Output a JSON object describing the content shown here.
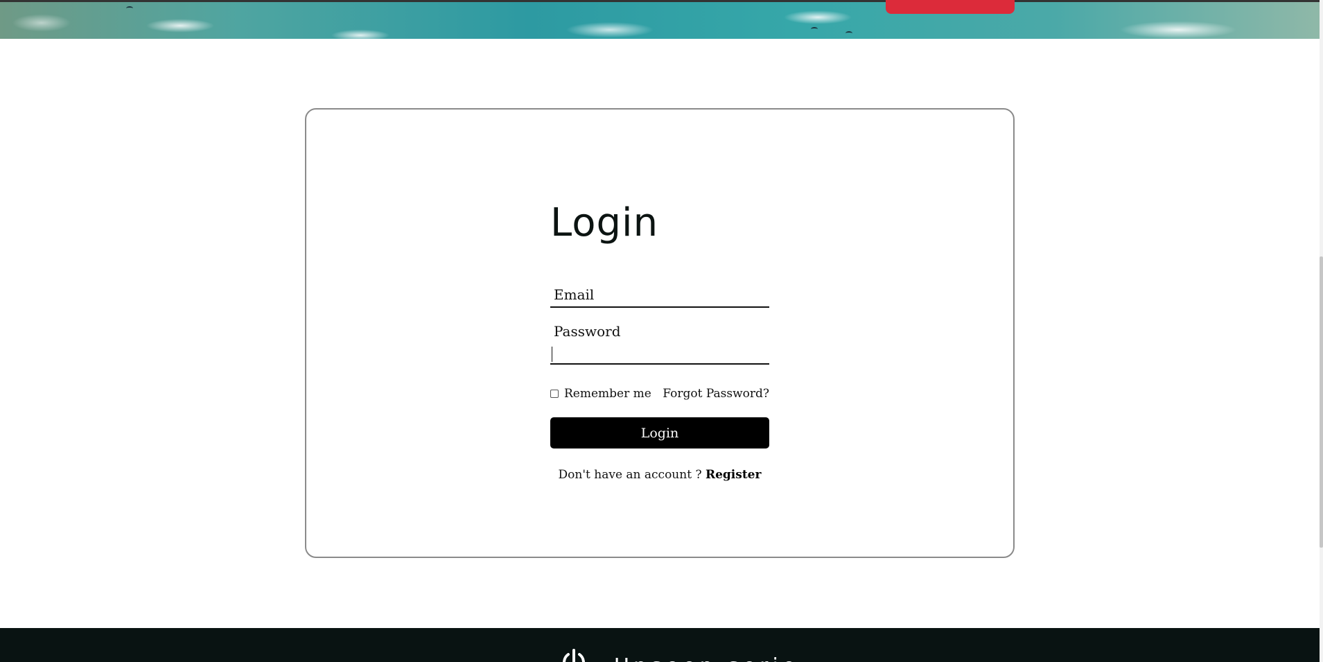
{
  "banner": {
    "accent_color": "#dc2b3a"
  },
  "login": {
    "title": "Login",
    "email_placeholder": "Email",
    "password_label": "Password",
    "password_value": "",
    "remember_label": "Remember me",
    "remember_checked": false,
    "forgot_label": "Forgot Password?",
    "submit_label": "Login",
    "register_prompt": "Don't have an account ? ",
    "register_link": "Register"
  },
  "footer": {
    "background": "#091312",
    "logo_icon": "power-icon",
    "brand_text": "Unseen serie"
  }
}
